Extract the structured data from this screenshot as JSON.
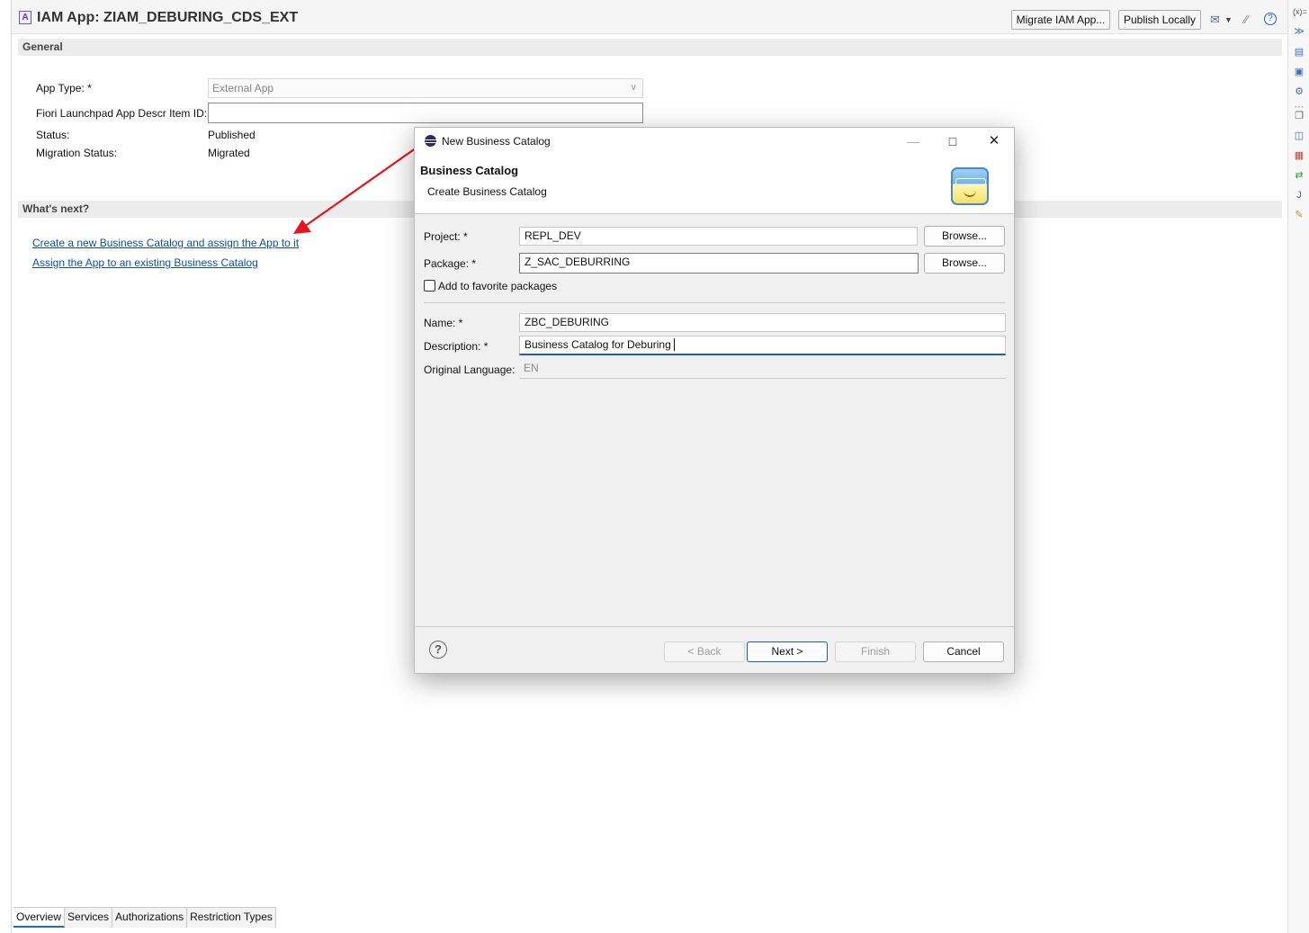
{
  "editor": {
    "title": "IAM App: ZIAM_DEBURING_CDS_EXT",
    "toolbar": {
      "migrate_label": "Migrate IAM App...",
      "publish_label": "Publish Locally"
    },
    "general_section": "General",
    "fields": {
      "app_type_label": "App Type: *",
      "app_type_value": "External App",
      "fiori_label": "Fiori Launchpad App Descr Item ID:",
      "fiori_value": "",
      "status_label": "Status:",
      "status_value": "Published",
      "migration_label": "Migration Status:",
      "migration_value": "Migrated"
    },
    "whats_next_section": "What's next?",
    "links": {
      "create_catalog": "Create a new Business Catalog and assign the App to it",
      "assign_existing": "Assign the App to an existing Business Catalog"
    },
    "bottom_tabs": [
      "Overview",
      "Services",
      "Authorizations",
      "Restriction Types"
    ]
  },
  "dialog": {
    "title": "New Business Catalog",
    "banner_title": "Business Catalog",
    "banner_subtitle": "Create Business Catalog",
    "project_label": "Project: *",
    "project_value": "REPL_DEV",
    "package_label": "Package: *",
    "package_value": "Z_SAC_DEBURRING",
    "browse_label": "Browse...",
    "favorite_label": "Add to favorite packages",
    "name_label": "Name: *",
    "name_value": "ZBC_DEBURING",
    "description_label": "Description: *",
    "description_value": "Business Catalog for Deburing",
    "language_label": "Original Language:",
    "language_value": "EN",
    "back_label": "< Back",
    "next_label": "Next >",
    "finish_label": "Finish",
    "cancel_label": "Cancel",
    "help_glyph": "?"
  },
  "annotation": {
    "arrow_color": "#e8141c"
  }
}
